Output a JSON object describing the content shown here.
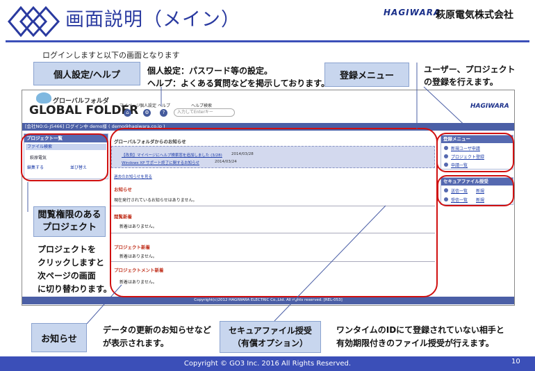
{
  "header": {
    "title": "画面説明（メイン）",
    "brand": "HAGIWARA",
    "company": "萩原電気株式会社"
  },
  "intro": "ログインしますと以下の画面となります",
  "callouts": {
    "personal": "個人設定/ヘルプ",
    "personal_desc_1": "個人設定：パスワード等の設定。",
    "personal_desc_2": "ヘルプ：よくある質問などを掲示しております。",
    "register": "登録メニュー",
    "register_desc_1": "ユーザー、プロジェクト",
    "register_desc_2": "の登録を行えます。",
    "browse": "閲覧権限のある\nプロジェクト",
    "browse_desc_1": "プロジェクトを",
    "browse_desc_2": "クリックしますと",
    "browse_desc_3": "次ページの画面",
    "browse_desc_4": "に切り替わります。",
    "notice": "お知らせ",
    "notice_desc_1": "データの更新のお知らせなど",
    "notice_desc_2": "が表示されます。",
    "secure": "セキュアファイル授受\n（有償オプション）",
    "secure_desc_1": "ワンタイムのIDにて登録されていない相手と",
    "secure_desc_2": "有効期限付きのファイル授受が行えます。"
  },
  "screen": {
    "logo_ja": "グローバルフォルダ",
    "logo_en": "GLOBAL FOLDER",
    "nav": [
      "マイページ",
      "個人設定",
      "ヘルプ",
      "ヘルプ検索"
    ],
    "search_placeholder": "入力してEnterキー",
    "brand": "HAGIWARA",
    "status_bar": "[会社NO:G-J5466] ログイン中 demo様 ( demo@hagiwara.co.jp )",
    "project_panel": {
      "title": "プロジェクト一覧",
      "search": "ファイル検索",
      "item": "萩原電気",
      "edit": "編集する",
      "sort": "並び替え"
    },
    "center": {
      "gf_notice_title": "グローバルフォルダからのお知らせ",
      "gf_notices": [
        {
          "text": "【改良】マイページにヘルプ検索窓を追加しました (3/28)",
          "date": "2014/03/28"
        },
        {
          "text": "Windows XP サポート終了に関するお知らせ",
          "date": "2014/03/24"
        }
      ],
      "past_link": "過去のお知らせを見る",
      "notice_title": "お知らせ",
      "notice_text": "現在発行されているお知らせはありません。",
      "latest_title": "閲覧新着",
      "latest_text": "新着はありません。",
      "project_new_title": "プロジェクト新着",
      "project_new_text": "新着はありません。",
      "doc_new_title": "プロジェクトメント新着",
      "doc_new_text": "新着はありません。"
    },
    "register_menu": {
      "title": "登録メニュー",
      "items": [
        "新規ユーザ申請",
        "プロジェクト登録",
        "申請一覧"
      ]
    },
    "secure_menu": {
      "title": "セキュアファイル授受",
      "items": [
        "送信一覧",
        "新規",
        "受信一覧",
        "新規"
      ]
    },
    "footer": "Copyright(c)2012 HAGIWARA ELECTRIC Co.,Ltd. All rights reserved.  [REL-053]"
  },
  "footer": {
    "copyright": "Copyright © GO3 Inc. 2016  All Rights Reserved.",
    "page": "10"
  }
}
